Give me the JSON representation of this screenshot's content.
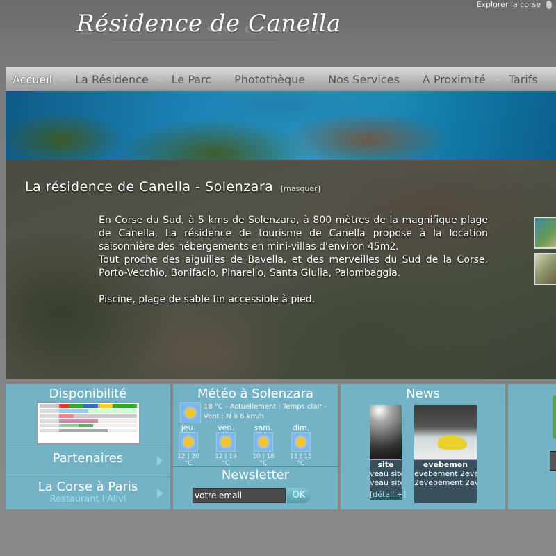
{
  "header": {
    "logo_text": "Résidence de Canella",
    "explore_link": "Explorer la corse"
  },
  "nav": {
    "items": [
      "Accueil",
      "La Résidence",
      "Le Parc",
      "Photothèque",
      "Nos Services",
      "A Proximité",
      "Tarifs"
    ],
    "active": "Accueil"
  },
  "hero": {
    "title": "La résidence de Canella - Solenzara",
    "hide_link": "[masquer]",
    "paragraph1": "En Corse du Sud, à 5 kms de Solenzara, à 800 mètres de la magnifique plage de Canella, La résidence de tourisme de Canella propose à la location saisonnière des hébergements en mini-villas d'environ 45m2.",
    "paragraph2": "Tout proche des aiguilles de Bavella, et des merveilles du Sud de la Corse, Porto-Vecchio, Bonifacio, Pinarello, Santa Giulia, Palombaggia.",
    "paragraph3": "Piscine, plage de sable fin accessible à pied."
  },
  "dispo": {
    "title": "Disponibilité"
  },
  "partenaires": {
    "label": "Partenaires"
  },
  "corse_paris": {
    "label": "La Corse à Paris",
    "sub": "Restaurant l'Alivi"
  },
  "meteo": {
    "title": "Météo à Solenzara",
    "current": "18 °C - Actuellement : Temps clair - Vent : N à 6 km/h",
    "days": [
      {
        "name": "jeu.",
        "temp": "12 | 20 °C",
        "icon": "sun-icon"
      },
      {
        "name": "ven.",
        "temp": "12 | 19 °C",
        "icon": "sun-cloud-icon"
      },
      {
        "name": "sam.",
        "temp": "10 | 18 °C",
        "icon": "sun-cloud-icon"
      },
      {
        "name": "dim.",
        "temp": "11 | 15 °C",
        "icon": "sun-icon"
      }
    ]
  },
  "newsletter": {
    "title": "Newsletter",
    "email_value": "votre email",
    "ok_label": "OK"
  },
  "news": {
    "title": "News",
    "item1_heading": "site",
    "item1_line1": "veau site",
    "item1_line2": "veau site",
    "item2_heading": "evebemen",
    "item2_line1": "evebement 2eve",
    "item2_line2": "2evebement 2ev",
    "detail_link": "[détail +]"
  },
  "colors": {
    "panel": "#74b3c6",
    "nav_gradient_top": "#d9d9d9",
    "link": "#9fe3ec"
  }
}
